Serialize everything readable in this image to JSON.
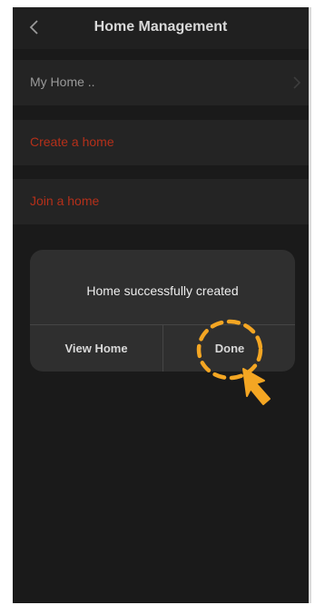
{
  "header": {
    "title": "Home Management",
    "back_icon": "chevron-left-icon"
  },
  "list": {
    "items": [
      {
        "label": "My Home ..",
        "style": "normal",
        "trailing_icon": "chevron-right-icon"
      },
      {
        "label": "Create a home",
        "style": "accent"
      },
      {
        "label": "Join a home",
        "style": "accent"
      }
    ]
  },
  "dialog": {
    "message": "Home successfully created",
    "secondary_button": "View Home",
    "primary_button": "Done"
  },
  "annotation": {
    "target": "Done",
    "indicator_icons": [
      "dashed-circle-icon",
      "pointer-arrow-icon"
    ],
    "color": "#f4a623"
  },
  "colors": {
    "background": "#1a1a1a",
    "row_background": "#242424",
    "accent_text": "#b5301a",
    "dialog_background": "#2f2f2f"
  }
}
